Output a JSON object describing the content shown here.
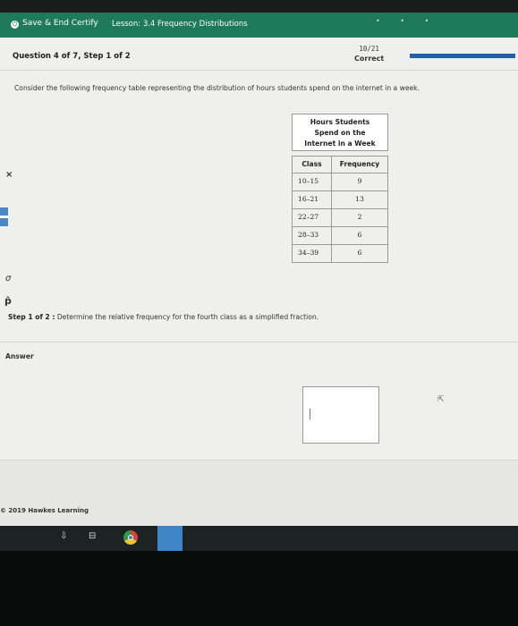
{
  "header": {
    "save_label": "Save & End Certify",
    "lesson_title": "Lesson: 3.4 Frequency Distributions"
  },
  "question": {
    "info": "Question 4 of 7, Step 1 of 2",
    "score": "10/21",
    "status": "Correct",
    "progress_fraction": 1.0
  },
  "intro": "Consider the following frequency table representing the distribution of hours students spend on the internet in a week.",
  "table": {
    "caption_lines": [
      "Hours Students",
      "Spend on the",
      "Internet in a Week"
    ],
    "headers": [
      "Class",
      "Frequency"
    ],
    "rows": [
      [
        "10–15",
        "9"
      ],
      [
        "16–21",
        "13"
      ],
      [
        "22–27",
        "2"
      ],
      [
        "28–33",
        "6"
      ],
      [
        "34–39",
        "6"
      ]
    ]
  },
  "tools": {
    "x": "×",
    "sigma": "σ",
    "phat": "p̂"
  },
  "step": {
    "label": "Step 1 of 2 :",
    "text": "Determine the relative frequency for the fourth class as a simplified fraction."
  },
  "answer_label": "Answer",
  "copyright": "© 2019 Hawkes Learning",
  "taskbar": {
    "download_icon": "⇩",
    "task_icon": "⊟"
  },
  "colors": {
    "header_green": "#1e7a5a",
    "progress_blue": "#1e5fa8",
    "tool_blue": "#4a87c7"
  }
}
